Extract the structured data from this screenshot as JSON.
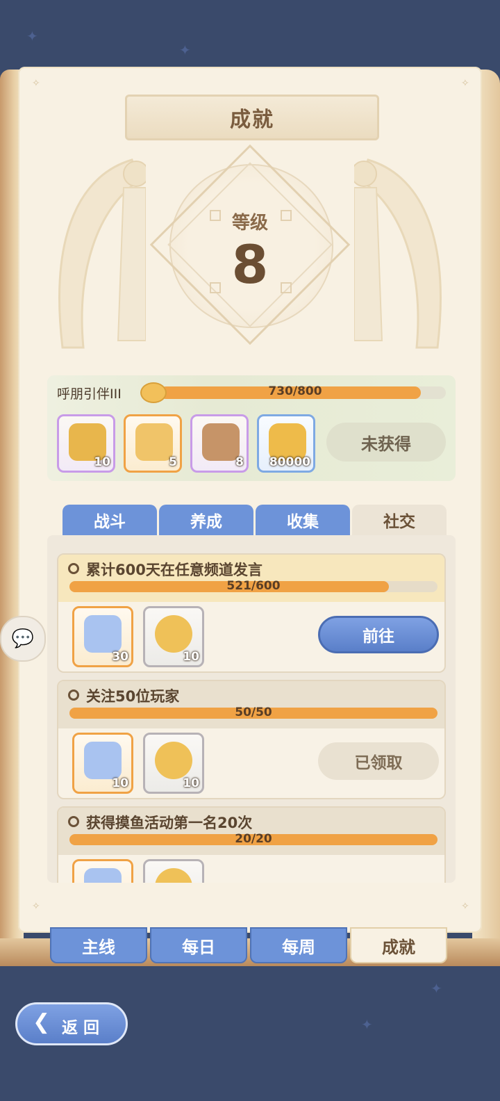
{
  "title": "成就",
  "level": {
    "label": "等级",
    "value": "8"
  },
  "rank": {
    "name": "呼朋引伴III",
    "progress_text": "730/800",
    "progress": 0.9125,
    "rewards": [
      {
        "icon": "star-badge-icon",
        "count": "10",
        "rarity": "purple"
      },
      {
        "icon": "lyre-icon",
        "count": "5",
        "rarity": "orange"
      },
      {
        "icon": "book-icon",
        "count": "8",
        "rarity": "purple"
      },
      {
        "icon": "gold-coin-icon",
        "count": "80000",
        "rarity": "blue"
      }
    ],
    "status_label": "未获得"
  },
  "category_tabs": [
    {
      "label": "战斗",
      "active": false
    },
    {
      "label": "养成",
      "active": false
    },
    {
      "label": "收集",
      "active": false
    },
    {
      "label": "社交",
      "active": true
    }
  ],
  "tasks": [
    {
      "title": "累计600天在任意频道发言",
      "progress_text": "521/600",
      "progress": 0.868,
      "rewards": [
        {
          "icon": "crystal-star-icon",
          "count": "30"
        },
        {
          "icon": "friend-medal-icon",
          "count": "10"
        }
      ],
      "action_label": "前往",
      "action_state": "go"
    },
    {
      "title": "关注50位玩家",
      "progress_text": "50/50",
      "progress": 1.0,
      "rewards": [
        {
          "icon": "crystal-star-icon",
          "count": "10"
        },
        {
          "icon": "friend-medal-icon",
          "count": "10"
        }
      ],
      "action_label": "已领取",
      "action_state": "claimed"
    },
    {
      "title": "获得摸鱼活动第一名20次",
      "progress_text": "20/20",
      "progress": 1.0,
      "rewards": [
        {
          "icon": "crystal-star-icon",
          "count": ""
        },
        {
          "icon": "friend-medal-icon",
          "count": ""
        }
      ],
      "action_label": "",
      "action_state": "claimed"
    }
  ],
  "page_tabs": [
    {
      "label": "主线",
      "active": false
    },
    {
      "label": "每日",
      "active": false
    },
    {
      "label": "每周",
      "active": false
    },
    {
      "label": "成就",
      "active": true
    }
  ],
  "back_label": "返回",
  "colors": {
    "accent": "#6d93d9",
    "progress": "#f0a245",
    "paper": "#f8f1e3"
  }
}
